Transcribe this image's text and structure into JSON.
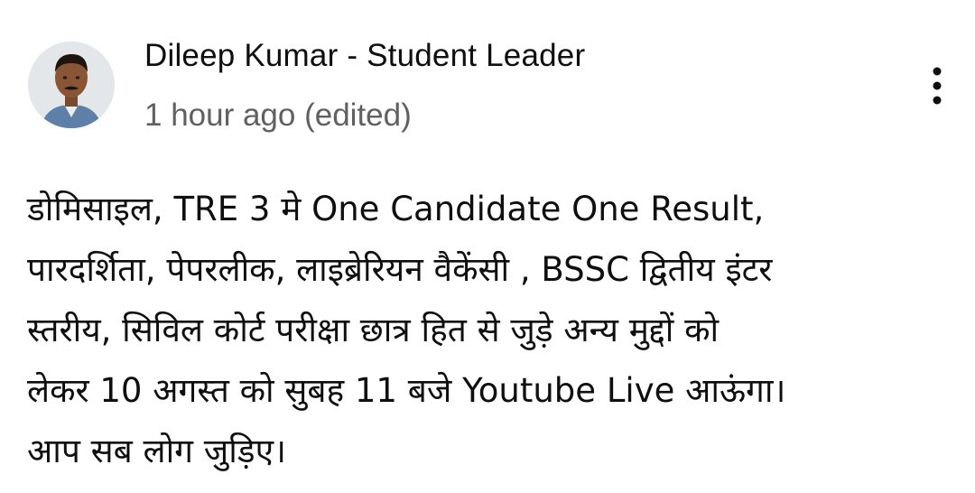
{
  "post": {
    "author": "Dileep Kumar - Student Leader",
    "timestamp": "1 hour ago (edited)",
    "avatar_icon": "user-avatar-icon",
    "more_icon": "more-vertical-icon",
    "body_text": "डोमिसाइल, TRE  3 मे One Candidate One Result,\nपारदर्शिता, पेपरलीक, लाइब्रेरियन वैकेंसी , BSSC द्वितीय इंटर\nस्तरीय, सिविल कोर्ट परीक्षा छात्र हित से जुड़े अन्य मुद्दों को\nलेकर  10 अगस्त को सुबह 11 बजे Youtube Live आऊंगा।\nआप सब लोग जुड़िए।"
  },
  "colors": {
    "primary_text": "#0f0f0f",
    "secondary_text": "#606060",
    "background": "#ffffff"
  }
}
